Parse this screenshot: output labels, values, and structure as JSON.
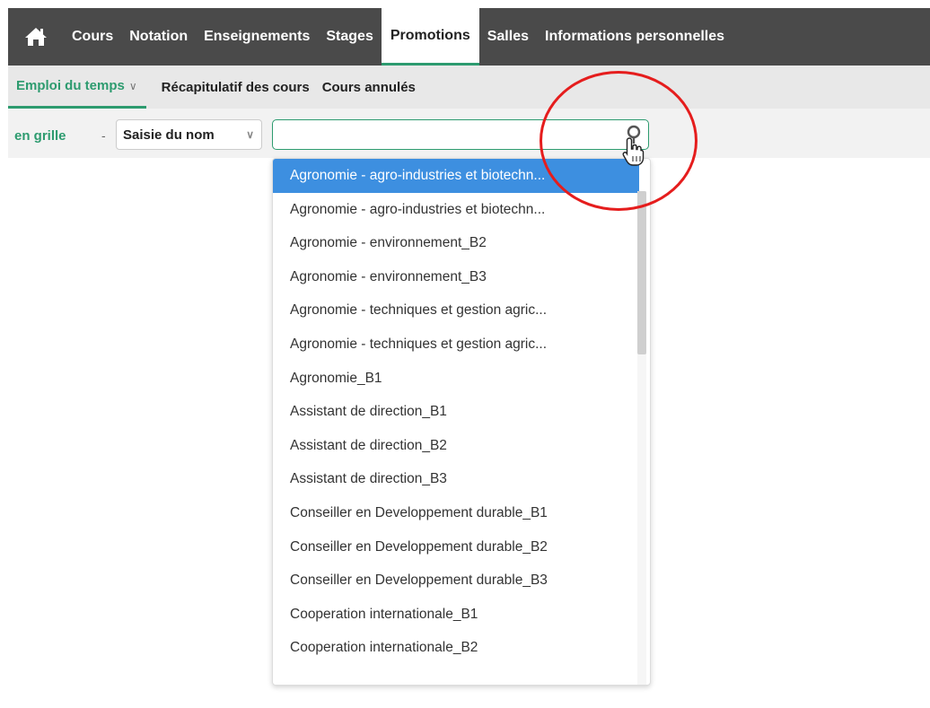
{
  "nav": {
    "tabs": [
      {
        "label": "Cours"
      },
      {
        "label": "Notation"
      },
      {
        "label": "Enseignements"
      },
      {
        "label": "Stages"
      },
      {
        "label": "Promotions"
      },
      {
        "label": "Salles"
      },
      {
        "label": "Informations personnelles"
      }
    ],
    "active": "Promotions"
  },
  "subnav": {
    "tabs": [
      {
        "label": "Emploi du temps"
      },
      {
        "label": "Récapitulatif des cours"
      },
      {
        "label": "Cours annulés"
      }
    ]
  },
  "filter": {
    "view_label": "en grille",
    "separator": "-",
    "select_value": "Saisie du nom",
    "search_value": ""
  },
  "dropdown": {
    "items": [
      "Agronomie - agro-industries et biotechn...",
      "Agronomie - agro-industries et biotechn...",
      "Agronomie - environnement_B2",
      "Agronomie - environnement_B3",
      "Agronomie - techniques et gestion agric...",
      "Agronomie - techniques et gestion agric...",
      "Agronomie_B1",
      "Assistant de direction_B1",
      "Assistant de direction_B2",
      "Assistant de direction_B3",
      "Conseiller en Developpement durable_B1",
      "Conseiller en Developpement durable_B2",
      "Conseiller en Developpement durable_B3",
      "Cooperation internationale_B1",
      "Cooperation internationale_B2"
    ],
    "highlighted_index": 0
  },
  "colors": {
    "accent": "#2d9b6f",
    "topbar": "#4a4a4a",
    "highlight": "#3d8fe0",
    "annotation": "#e51d1d"
  },
  "icons": {
    "home": "home-icon",
    "search": "search-icon",
    "cursor": "hand-pointer-icon"
  }
}
